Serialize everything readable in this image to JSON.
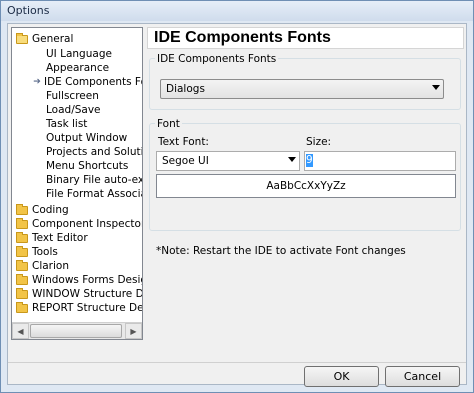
{
  "window": {
    "title": "Options"
  },
  "tree": {
    "items": [
      {
        "label": "General",
        "type": "folder-open"
      },
      {
        "label": "UI Language",
        "type": "child"
      },
      {
        "label": "Appearance",
        "type": "child"
      },
      {
        "label": "IDE Components Fonts",
        "type": "child-selected"
      },
      {
        "label": "Fullscreen",
        "type": "child"
      },
      {
        "label": "Load/Save",
        "type": "child"
      },
      {
        "label": "Task list",
        "type": "child"
      },
      {
        "label": "Output Window",
        "type": "child"
      },
      {
        "label": "Projects and Solutions",
        "type": "child"
      },
      {
        "label": "Menu Shortcuts",
        "type": "child"
      },
      {
        "label": "Binary File auto-export",
        "type": "child"
      },
      {
        "label": "File Format Associations",
        "type": "child"
      },
      {
        "label": "Coding",
        "type": "folder"
      },
      {
        "label": "Component Inspector",
        "type": "folder"
      },
      {
        "label": "Text Editor",
        "type": "folder"
      },
      {
        "label": "Tools",
        "type": "folder"
      },
      {
        "label": "Clarion",
        "type": "folder"
      },
      {
        "label": "Windows Forms Designer",
        "type": "folder"
      },
      {
        "label": "WINDOW Structure Designer",
        "type": "folder"
      },
      {
        "label": "REPORT Structure Designer",
        "type": "folder"
      }
    ]
  },
  "panel": {
    "title": "IDE Components Fonts",
    "components_group_label": "IDE Components Fonts",
    "components_selected": "Dialogs",
    "font_group_label": "Font",
    "text_font_label": "Text Font:",
    "text_font_value": "Segoe UI",
    "size_label": "Size:",
    "size_value": "9",
    "sample_text": "AaBbCcXxYyZz",
    "note": "*Note: Restart the IDE to activate Font changes"
  },
  "buttons": {
    "ok": "OK",
    "cancel": "Cancel"
  }
}
